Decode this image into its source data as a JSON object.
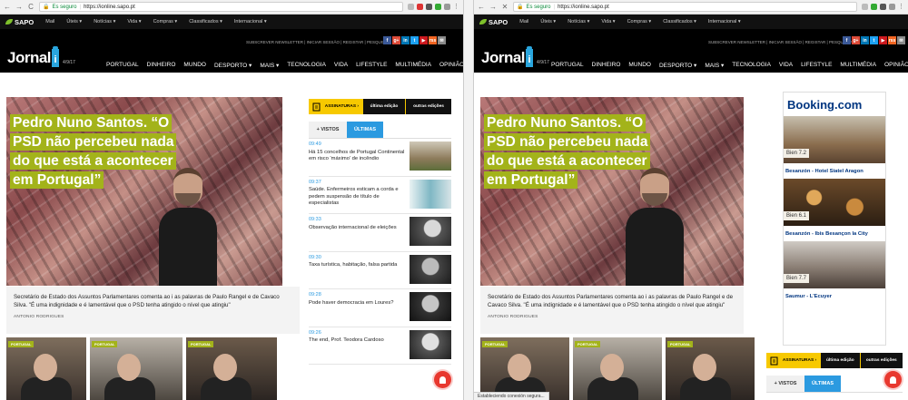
{
  "browser": {
    "secure_label": "Es seguro",
    "url": "https://ionline.sapo.pt"
  },
  "sapo_bar": {
    "logo": "SAPO",
    "links": [
      "Mail",
      "Úteis",
      "Notícias",
      "Vida",
      "Compras",
      "Classificados",
      "Internacional"
    ]
  },
  "masthead": {
    "top_links": "SUBSCREVER NEWSLETTER | INICIAR SESSÃO | REGISTAR | PESQUISAR",
    "logo_word": "Jornal",
    "logo_letter": "i",
    "date": "4/9/17",
    "social": [
      "f",
      "g+",
      "in",
      "t",
      "▶",
      "rss",
      "✉"
    ],
    "social_colors": [
      "#3b5998",
      "#dd4b39",
      "#0077b5",
      "#1da1f2",
      "#cc181e",
      "#f26522",
      "#8a8a8a"
    ],
    "nav": [
      "PORTUGAL",
      "DINHEIRO",
      "MUNDO",
      "DESPORTO",
      "MAIS",
      "TECNOLOGIA",
      "VIDA",
      "LIFESTYLE",
      "MULTIMÉDIA",
      "OPINIÃO"
    ]
  },
  "lead": {
    "headline": "Pedro Nuno Santos. “O PSD não percebeu nada do que está a acontecer em Portugal”",
    "excerpt": "Secretário de Estado dos Assuntos Parlamentares comenta ao i as palavras de Paulo Rangel e de Cavaco Silva. \"É uma indignidade e é lamentável que o PSD tenha atingido o nível que atingiu\"",
    "author": "ANTONIO RODRIGUES"
  },
  "section_tag": "PORTUGAL",
  "subscriptions": {
    "label": "ASSINATURAS",
    "last_edition": "última edição",
    "other_editions": "outras edições"
  },
  "tabs": {
    "most_seen": "+ VISTOS",
    "latest": "ÚLTIMAS"
  },
  "news": [
    {
      "time": "09:49",
      "title": "Há 15 concelhos de Portugal Continental em risco 'máximo' de incêndio"
    },
    {
      "time": "09:37",
      "title": "Saúde. Enfermeiros esticam a corda e pedem suspensão de título de especialistas"
    },
    {
      "time": "09:33",
      "title": "Observação internacional de eleições"
    },
    {
      "time": "09:30",
      "title": "Taxa turística, habitação, falsa partida"
    },
    {
      "time": "09:28",
      "title": "Pode haver democracia em Loures?"
    },
    {
      "time": "09:26",
      "title": "The end, Prof. Teodora Cardoso"
    }
  ],
  "ad": {
    "brand": "Booking.com",
    "hotels": [
      {
        "rating": "Bien 7.2",
        "name": "Besanzón - Hotel Siatel Aragon"
      },
      {
        "rating": "Bien 6.1",
        "name": "Besanzón - Ibis Besançon la City"
      },
      {
        "rating": "Bien 7.7",
        "name": "Saumur - L'Ecuyer"
      }
    ]
  },
  "status": "Estableciendo conexión segura..."
}
